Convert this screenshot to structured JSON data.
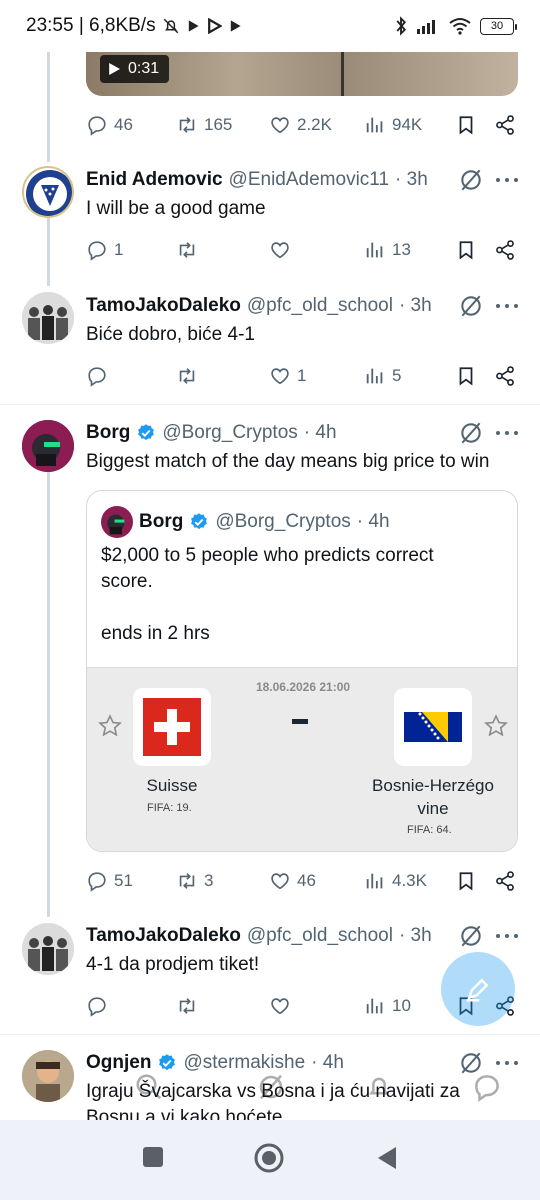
{
  "status_bar": {
    "time_speed": "23:55 | 6,8KB/s",
    "battery": "30"
  },
  "video": {
    "duration": "0:31"
  },
  "top_actions": {
    "replies": "46",
    "reposts": "165",
    "likes": "2.2K",
    "views": "94K"
  },
  "tweets": [
    {
      "name": "Enid Ademovic",
      "handle": "@EnidAdemovic11",
      "time": "· 3h",
      "text": "I will be a good game",
      "replies": "1",
      "reposts": "",
      "likes": "",
      "views": "13"
    },
    {
      "name": "TamoJakoDaleko",
      "handle": "@pfc_old_school",
      "time": "· 3h",
      "text": "Biće dobro, biće 4-1",
      "replies": "",
      "reposts": "",
      "likes": "1",
      "views": "5"
    },
    {
      "name": "Borg",
      "handle": "@Borg_Cryptos",
      "time": "· 4h",
      "text": "Biggest match of the day means big price to win",
      "replies": "51",
      "reposts": "3",
      "likes": "46",
      "views": "4.3K"
    },
    {
      "name": "TamoJakoDaleko",
      "handle": "@pfc_old_school",
      "time": "· 3h",
      "text": "4-1 da prodjem tiket!",
      "replies": "",
      "reposts": "",
      "likes": "",
      "views": "10"
    },
    {
      "name": "Ognjen",
      "handle": "@stermakishe",
      "time": "· 4h",
      "text_line1": "Igraju Švajcarska vs Bosna i ja ću navijati za",
      "text_line2": "Bosnu a vi kako hoćete"
    }
  ],
  "quote": {
    "name": "Borg",
    "handle": "@Borg_Cryptos",
    "time": "· 4h",
    "line1": "$2,000 to 5 people who predicts correct",
    "line2": "score.",
    "line3": "ends in 2 hrs",
    "match": {
      "datetime": "18.06.2026 21:00",
      "home": "Suisse",
      "home_fifa": "FIFA: 19.",
      "away_line1": "Bosnie-Herzégo",
      "away_line2": "vine",
      "away_fifa": "FIFA: 64."
    }
  },
  "colors": {
    "accent": "#1d9bf0",
    "muted": "#536471",
    "swiss_red": "#da291c",
    "bih_blue": "#002395",
    "bih_yellow": "#fecb00"
  }
}
